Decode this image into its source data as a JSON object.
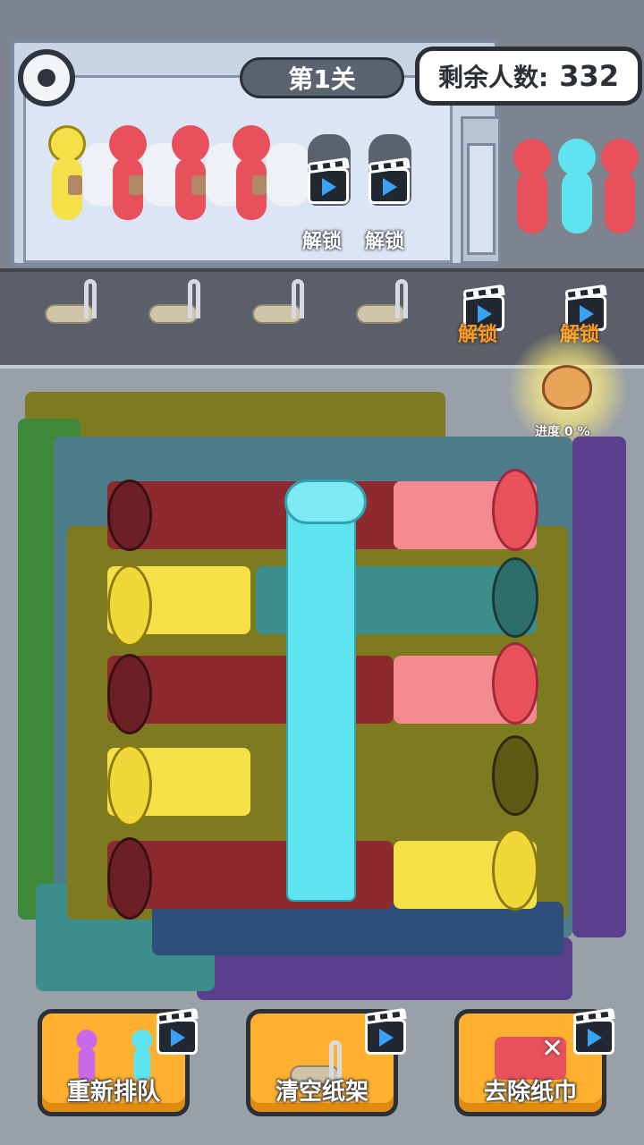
{
  "header": {
    "level_label": "第1关",
    "remaining_label": "剩余人数:",
    "remaining_count": "332"
  },
  "stalls": {
    "unlock_labels": [
      "解锁",
      "解锁"
    ]
  },
  "holders": {
    "unlock_labels": [
      "解锁",
      "解锁"
    ]
  },
  "progress": {
    "label": "进度 0 %"
  },
  "buttons": {
    "requeue_label": "重新排队",
    "clear_rack_label": "清空纸架",
    "remove_tissue_label": "去除纸巾"
  },
  "colors": {
    "red": "#e8505b",
    "yellow": "#f5e04a",
    "cyan": "#5ee4f0",
    "dark_red": "#8c2a30",
    "olive": "#7e7a20",
    "teal": "#3b8e8c",
    "navy": "#2d4f7a",
    "green": "#3f8a3a",
    "purple": "#5a3f8c",
    "pink": "#f28a8e"
  },
  "queue_colors": [
    "red",
    "cyan",
    "red"
  ],
  "stall_colors": [
    "yellow",
    "red",
    "red",
    "red"
  ]
}
